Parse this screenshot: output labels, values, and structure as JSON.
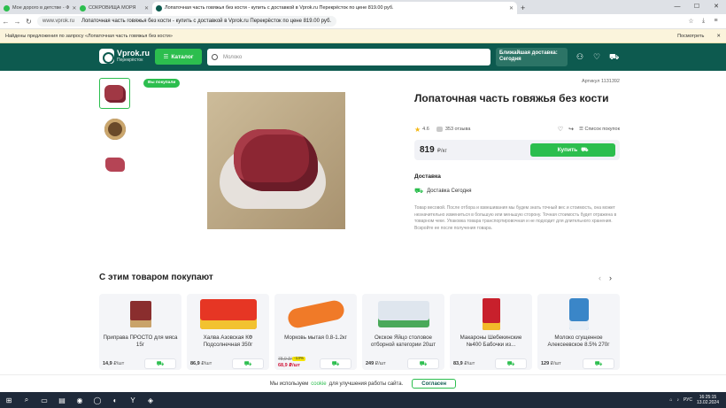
{
  "browser": {
    "tabs": [
      {
        "label": "Мое дорого в детстве - Ф",
        "color": "#2cbe4e"
      },
      {
        "label": "СОКРОВИЩА МОРЯ",
        "color": "#2cbe4e"
      },
      {
        "label": "Лопаточная часть говяжья без кости - купить с доставкой в Vprok.ru Перекрёсток по цене 819.00 руб.",
        "color": "#0d5a4f"
      }
    ],
    "url_host": "www.vprok.ru",
    "url_title": "Лопаточная часть говяжья без кости - купить с доставкой в Vprok.ru Перекрёсток по цене 819.00 руб.",
    "findbar_text": "Найдены предложения по запросу «Лопаточная часть говяжья без кости»",
    "findbar_action": "Посмотреть"
  },
  "header": {
    "logo_main": "Vprok.ru",
    "logo_sub": "Перекрёсток",
    "catalog_label": "Каталог",
    "search_placeholder": "Молоко",
    "delivery_line1": "Ближайшая доставка:",
    "delivery_line2": "Сегодня"
  },
  "product": {
    "badge": "Вы покупали",
    "artikul": "Артикул 1131392",
    "title": "Лопаточная часть говяжья без кости",
    "rating": "4.6",
    "reviews": "353 отзыва",
    "shopping_list": "Список покупок",
    "price": "819",
    "price_unit": "₽/кг",
    "buy_label": "Купить",
    "delivery_heading": "Доставка",
    "delivery_text": "Доставка Сегодня",
    "description": "Товар весовой. После отбора и взвешивания мы будем знать точный вес и стоимость, она может незначительно измениться в большую или меньшую сторону. Точная стоимость будет отражена в товарном чеке. Упаковка товара транспортировочная и не подходит для длительного хранения. Вскройте ее после получения товара."
  },
  "related": {
    "heading": "С этим товаром покупают",
    "items": [
      {
        "name": "Приправа ПРОСТО для мяса 15г",
        "price": "14,9",
        "unit": "₽/шт"
      },
      {
        "name": "Халва Азовская КФ Подсолнечная 350г",
        "price": "86,9",
        "unit": "₽/шт"
      },
      {
        "name": "Морковь мытая 0.8-1.2кг",
        "old_price": "78,9 ₽/шт",
        "discount": "-13%",
        "price": "68,9",
        "unit": "₽/шт"
      },
      {
        "name": "Окское Яйцо столовое отборной категории 20шт",
        "price": "249",
        "unit": "₽/шт"
      },
      {
        "name": "Макароны Шебекинские №400 Бабочки из...",
        "price": "83,9",
        "unit": "₽/шт"
      },
      {
        "name": "Молоко сгущенное Алексеевское 8.5% 270г",
        "price": "129",
        "unit": "₽/шт"
      }
    ]
  },
  "cookie": {
    "text_before": "Мы используем",
    "link": "cookie",
    "text_after": "для улучшения работы сайта.",
    "button": "Согласен"
  },
  "taskbar": {
    "lang": "РУС",
    "time": "16:25:15",
    "date": "13.02.2024"
  }
}
